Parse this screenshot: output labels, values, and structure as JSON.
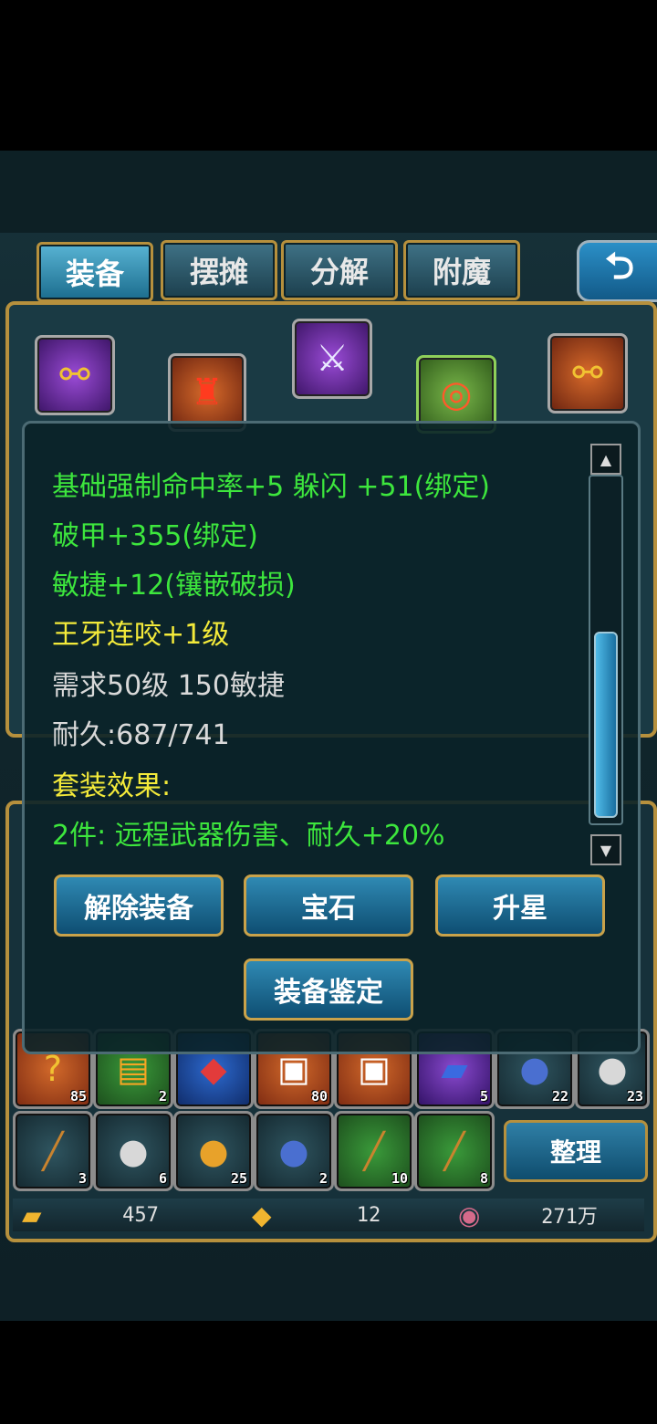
{
  "tabs": [
    {
      "label": "装备",
      "active": true
    },
    {
      "label": "摆摊",
      "active": false
    },
    {
      "label": "分解",
      "active": false
    },
    {
      "label": "附魔",
      "active": false
    }
  ],
  "back_icon": "back-arrow-icon",
  "equip_slots": [
    {
      "icon": "chain-necklace-icon",
      "glyph": "⚯",
      "rarity": "purple"
    },
    {
      "icon": "red-armor-icon",
      "glyph": "♜",
      "rarity": "orange"
    },
    {
      "icon": "wings-icon",
      "glyph": "⚔",
      "rarity": "purple"
    },
    {
      "icon": "bowl-icon",
      "glyph": "◎",
      "rarity": "green"
    },
    {
      "icon": "chain-necklace-icon",
      "glyph": "⚯",
      "rarity": "orange"
    }
  ],
  "tooltip": {
    "lines": [
      {
        "text": "基础强制命中率+5 躲闪 +51(绑定)",
        "color": "green"
      },
      {
        "text": "破甲+355(绑定)",
        "color": "green"
      },
      {
        "text": "敏捷+12(镶嵌破损)",
        "color": "green"
      },
      {
        "text": "王牙连咬+1级",
        "color": "yellow"
      },
      {
        "text": "需求50级  150敏捷",
        "color": "white"
      },
      {
        "text": "耐久:687/741",
        "color": "white"
      },
      {
        "text": "套装效果:",
        "color": "yellow"
      },
      {
        "text": "2件: 远程武器伤害、耐久+20%",
        "color": "green"
      }
    ],
    "scroll_position": 0.85,
    "buttons": {
      "unequip": "解除装备",
      "gem": "宝石",
      "star": "升星",
      "appraise": "装备鉴定"
    }
  },
  "bag_row1": [
    {
      "icon": "question-mark-icon",
      "glyph": "❓",
      "count": "85",
      "bg": "orange"
    },
    {
      "icon": "scroll-icon",
      "glyph": "📜",
      "count": "2",
      "bg": "green"
    },
    {
      "icon": "red-gem-icon",
      "glyph": "💎",
      "count": "",
      "bg": "blue"
    },
    {
      "icon": "gift-box-icon",
      "glyph": "🎁",
      "count": "80",
      "bg": "orange"
    },
    {
      "icon": "gift-box-icon",
      "glyph": "🎁",
      "count": "",
      "bg": "orange"
    },
    {
      "icon": "blue-book-icon",
      "glyph": "📘",
      "count": "5",
      "bg": "purple"
    },
    {
      "icon": "blue-ore-icon",
      "glyph": "🪨",
      "count": "22",
      "bg": ""
    },
    {
      "icon": "silver-ore-icon",
      "glyph": "🪨",
      "count": "23",
      "bg": ""
    }
  ],
  "bag_row2": [
    {
      "icon": "wood-log-icon",
      "glyph": "🪵",
      "count": "3",
      "bg": ""
    },
    {
      "icon": "silver-ore-icon",
      "glyph": "🪨",
      "count": "6",
      "bg": ""
    },
    {
      "icon": "money-bag-icon",
      "glyph": "💰",
      "count": "25",
      "bg": ""
    },
    {
      "icon": "blue-ore-icon",
      "glyph": "🪨",
      "count": "2",
      "bg": ""
    },
    {
      "icon": "wood-log-icon",
      "glyph": "🪵",
      "count": "10",
      "bg": "green"
    },
    {
      "icon": "wood-log-icon",
      "glyph": "🪵",
      "count": "8",
      "bg": "green"
    }
  ],
  "sort_label": "整理",
  "currency": [
    {
      "icon": "gold-ingot-icon",
      "glyph": "🟨",
      "value": "457"
    },
    {
      "icon": "gold-leaf-icon",
      "glyph": "🍂",
      "value": "12"
    },
    {
      "icon": "coin-icon",
      "glyph": "🪙",
      "value": "271万"
    }
  ]
}
